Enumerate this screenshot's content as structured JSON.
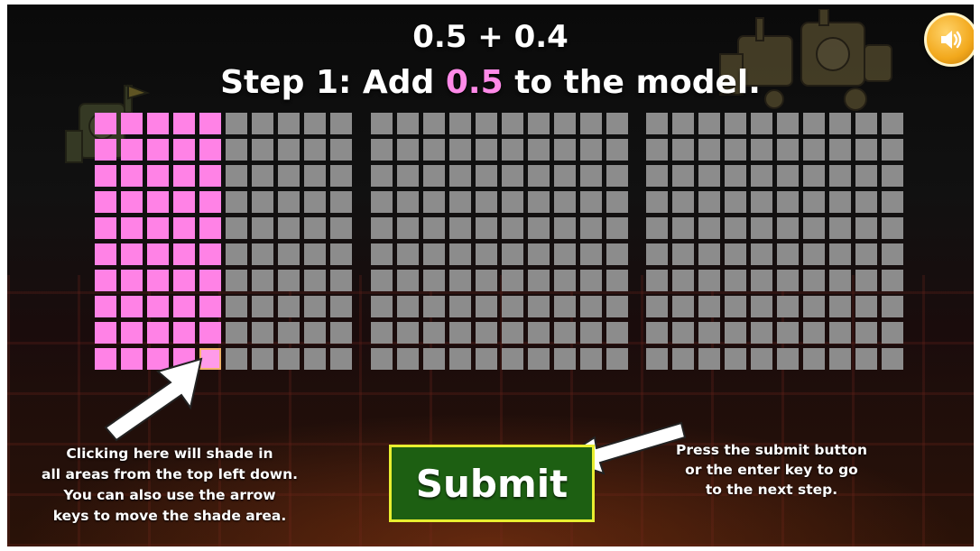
{
  "problem": {
    "expression": "0.5 + 0.4"
  },
  "step": {
    "prefix": "Step 1: Add ",
    "value": "0.5",
    "suffix": " to the model."
  },
  "model": {
    "grids": 3,
    "rows": 10,
    "cols": 10,
    "shaded_columns_grid1": 5,
    "shaded_value": 0.5,
    "colors": {
      "shaded": "#ff82e6",
      "empty": "#8c8c8c",
      "highlight": "#ff8ae8"
    }
  },
  "submit": {
    "label": "Submit"
  },
  "hints": {
    "left": [
      "Clicking here will shade in",
      "all areas from the top left down.",
      "You can also use the arrow",
      "keys to move the shade area."
    ],
    "right": [
      "Press the submit button",
      "or the enter key to go",
      "to the next step."
    ]
  },
  "icons": {
    "sound": "speaker-icon"
  }
}
